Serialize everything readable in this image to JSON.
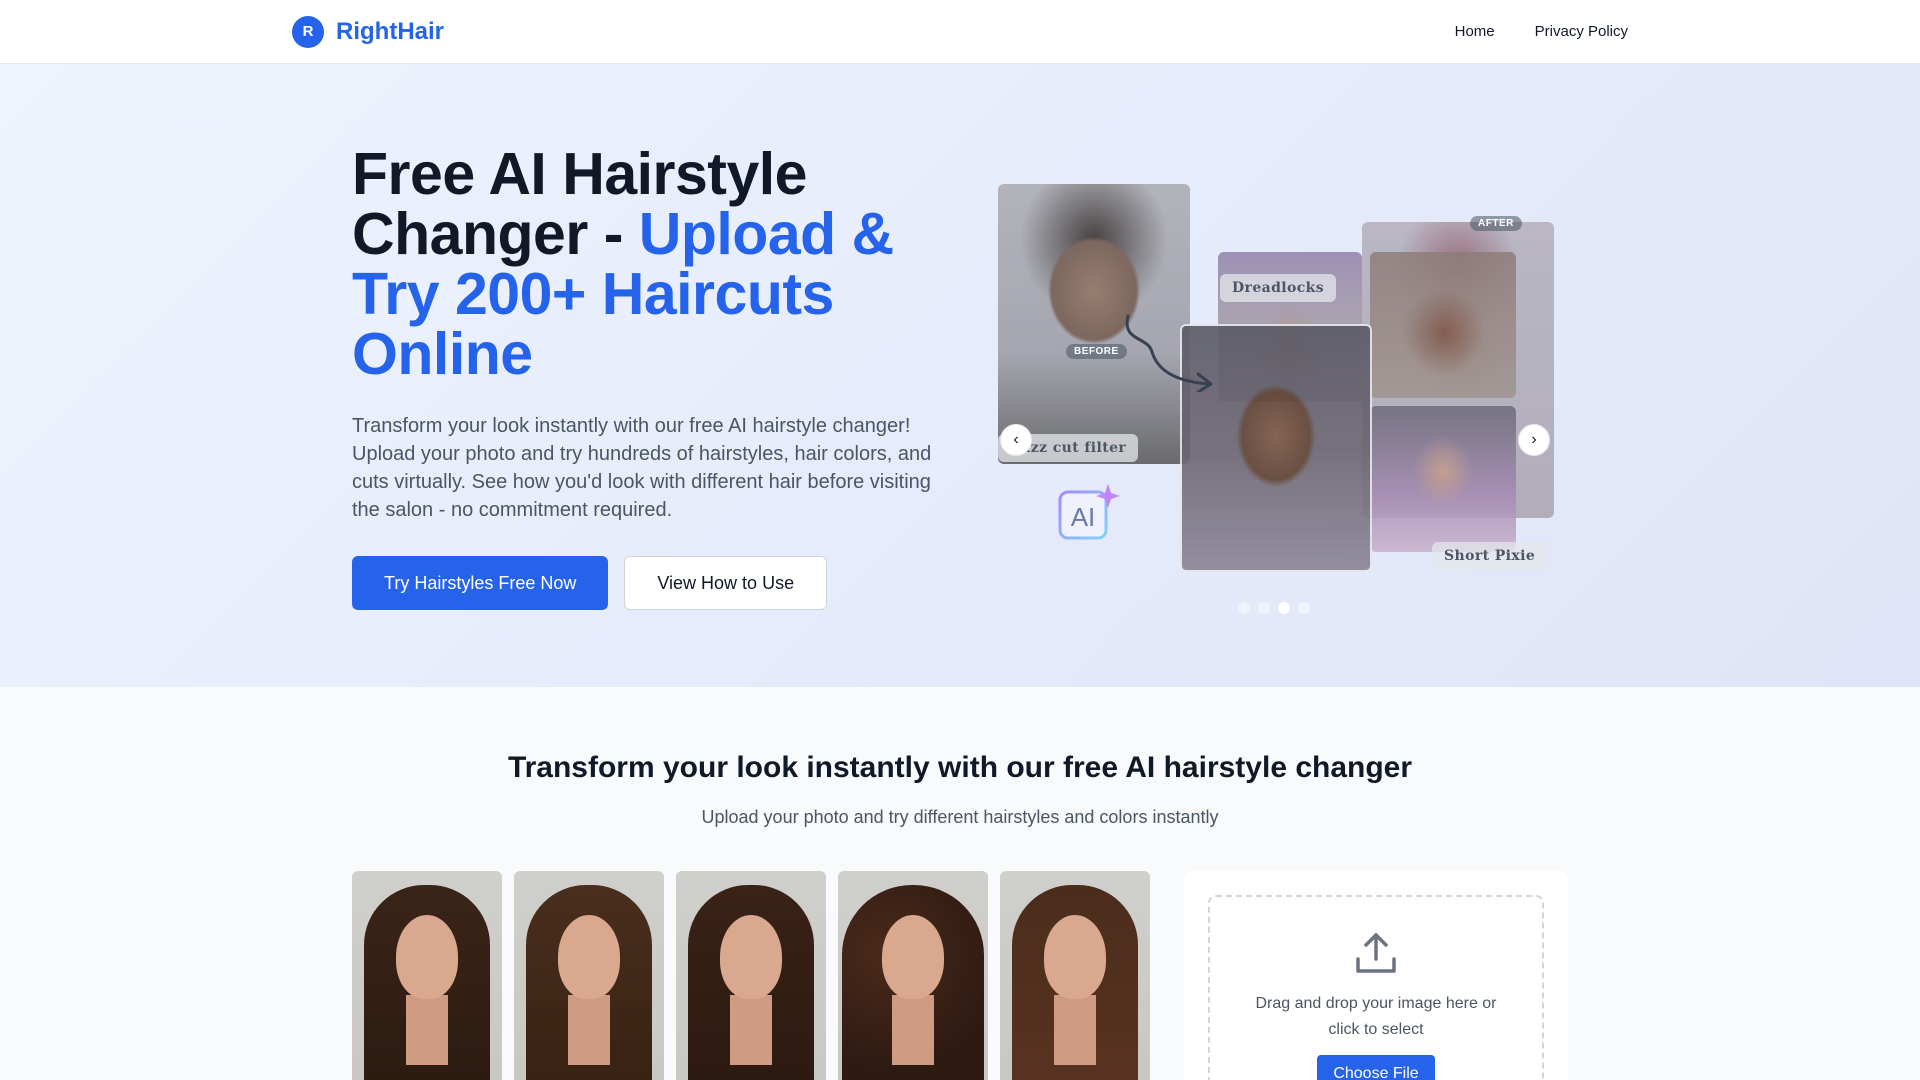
{
  "header": {
    "logo_letter": "R",
    "brand": "RightHair",
    "nav": [
      {
        "label": "Home"
      },
      {
        "label": "Privacy Policy"
      }
    ]
  },
  "hero": {
    "title_line1": "Free AI Hairstyle",
    "title_line2_plain": "Changer - ",
    "title_accent": "Upload & Try 200+ Haircuts Online",
    "description": "Transform your look instantly with our free AI hairstyle changer! Upload your photo and try hundreds of hairstyles, hair colors, and cuts virtually. See how you'd look with different hair before visiting the salon - no commitment required.",
    "primary_button": "Try Hairstyles Free Now",
    "secondary_button": "View How to Use",
    "collage": {
      "tag_before": "BEFORE",
      "tag_after": "AFTER",
      "label_buzz": "buzz cut filter",
      "label_dread": "Dreadlocks",
      "label_pixie": "Short Pixie",
      "ai_text": "AI",
      "prev_icon": "chevron-left-icon",
      "next_icon": "chevron-right-icon",
      "slide_count": 4,
      "active_slide": 3
    }
  },
  "showcase": {
    "title": "Transform your look instantly with our free AI hairstyle changer",
    "subtitle": "Upload your photo and try different hairstyles and colors instantly",
    "samples": [
      {
        "hair_color": "#3b2418"
      },
      {
        "hair_color": "#4a2e1e"
      },
      {
        "hair_color": "#3a2217"
      },
      {
        "hair_color": "#2f1a12"
      },
      {
        "hair_color": "#4b2c1b"
      }
    ]
  },
  "upload": {
    "icon": "upload-icon",
    "text": "Drag and drop your image here or click to select",
    "button": "Choose File"
  },
  "colors": {
    "accent": "#2563eb",
    "text_primary": "#111827",
    "text_secondary": "#4b5563"
  }
}
